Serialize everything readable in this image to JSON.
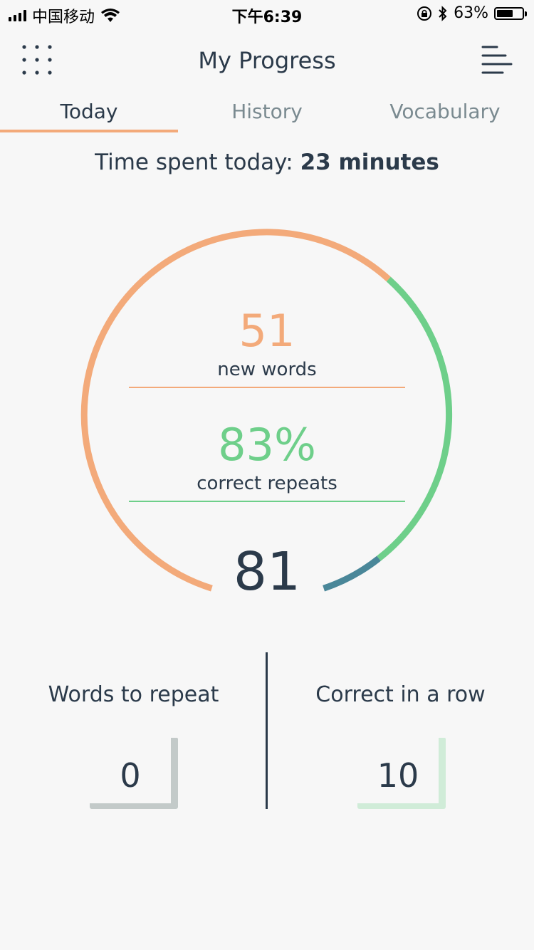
{
  "status_bar": {
    "carrier": "中国移动",
    "time": "下午6:39",
    "battery": "63%"
  },
  "header": {
    "title": "My Progress"
  },
  "tabs": [
    {
      "label": "Today",
      "active": true
    },
    {
      "label": "History",
      "active": false
    },
    {
      "label": "Vocabulary",
      "active": false
    }
  ],
  "time_spent": {
    "label": "Time spent today: ",
    "value": "23 minutes"
  },
  "ring": {
    "new_words": {
      "value": "51",
      "label": "new words"
    },
    "correct_repeats": {
      "value": "83%",
      "label": "correct repeats"
    },
    "total": "81",
    "colors": {
      "new": "#f3aa7a",
      "correct": "#6ecf8a",
      "other": "#4a8799"
    }
  },
  "stats": {
    "words_to_repeat": {
      "label": "Words to repeat",
      "value": "0"
    },
    "correct_in_row": {
      "label": "Correct in a row",
      "value": "10"
    }
  }
}
